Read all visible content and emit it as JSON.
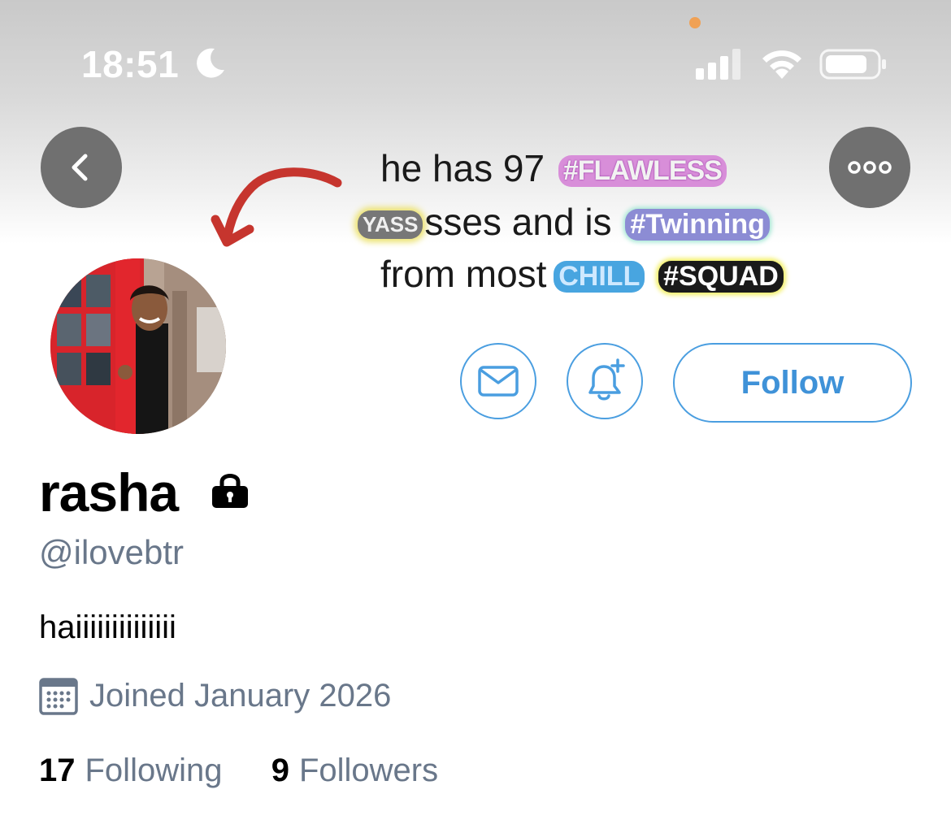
{
  "status_bar": {
    "time": "18:51",
    "icons": [
      "moon-icon",
      "signal-icon",
      "wifi-icon",
      "battery-icon"
    ]
  },
  "banner": {
    "meme_text": {
      "line1_start": "he has 97",
      "line1_sticker": "#FLAWLESS",
      "line2_sticker": "YASS",
      "line2_text": "sses and is",
      "line2_sticker2": "#Twinning",
      "line3_text": "from most",
      "line3_sticker": "CHILL",
      "line3_sticker2": "#SQUAD"
    }
  },
  "nav": {
    "back_icon": "chevron-left-icon",
    "more_icon": "more-dots-icon"
  },
  "actions": {
    "follow_label": "Follow",
    "message_icon": "mail-icon",
    "notify_icon": "bell-plus-icon"
  },
  "profile": {
    "display_name": "rasha",
    "protected_icon": "lock-icon",
    "handle": "@ilovebtr",
    "bio": "haiiiiiiiiiiiiii",
    "joined": "Joined January 2026",
    "following_count": "17",
    "following_label": "Following",
    "followers_count": "9",
    "followers_label": "Followers"
  },
  "colors": {
    "accent": "#4a9ee0",
    "secondary_text": "#69778a",
    "nav_button_bg": "#707070"
  }
}
